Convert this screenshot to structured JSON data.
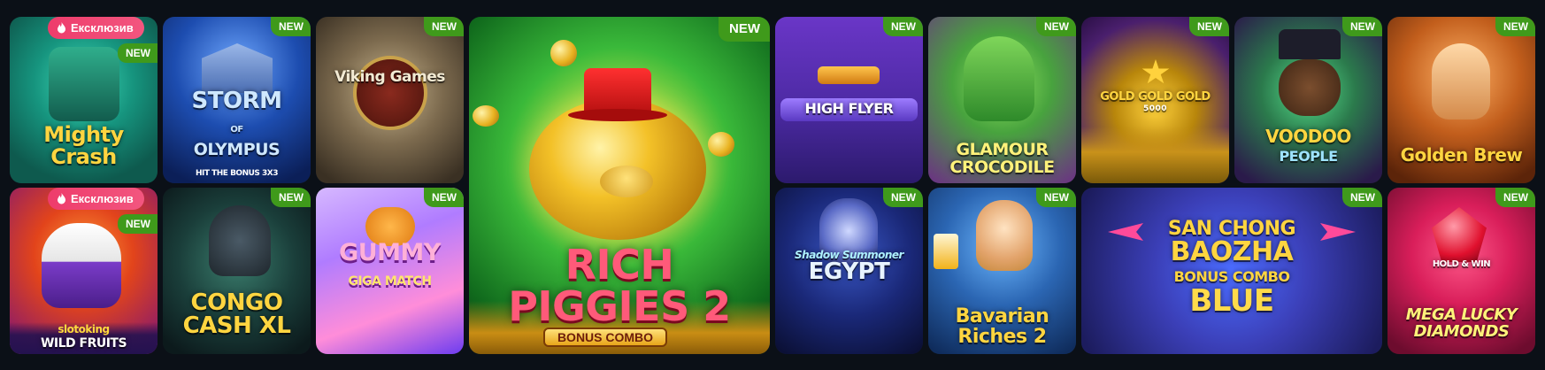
{
  "colors": {
    "background": "#0b1017",
    "new_badge": "#3f9a1b",
    "exclusive_badge": "#ee3c6b"
  },
  "badges": {
    "new": "NEW",
    "exclusive": "Ексклюзив"
  },
  "games": [
    {
      "id": "mighty-crash",
      "title": "Mighty Crash",
      "exclusive": true,
      "new": true
    },
    {
      "id": "storm-of-olympus",
      "title_line1": "STORM",
      "title_line2": "OLYMPUS",
      "title_of": "OF",
      "subtitle": "HIT THE BONUS 3X3",
      "new": true
    },
    {
      "id": "viking-games",
      "title": "Viking Games",
      "new": true
    },
    {
      "id": "rich-piggies-2",
      "title_line1": "RICH",
      "title_line2": "PIGGIES 2",
      "subtitle": "BONUS COMBO",
      "new": true
    },
    {
      "id": "high-flyer",
      "title": "HIGH FLYER",
      "new": true
    },
    {
      "id": "glamour-crocodile",
      "title_line1": "GLAMOUR",
      "title_line2": "CROCODILE",
      "new": true
    },
    {
      "id": "gold-gold-gold",
      "title": "GOLD GOLD GOLD",
      "subtitle": "5000",
      "new": true
    },
    {
      "id": "voodoo-people",
      "title_line1": "VOODOO",
      "title_line2": "PEOPLE",
      "new": true
    },
    {
      "id": "golden-brew",
      "title": "Golden Brew",
      "new": true
    },
    {
      "id": "wild-fruits",
      "brand": "slotoking",
      "title": "WILD FRUITS",
      "exclusive": true,
      "new": true
    },
    {
      "id": "congo-cash-xl",
      "title_line1": "CONGO",
      "title_line2": "CASH XL",
      "new": true
    },
    {
      "id": "gummy-giga-match",
      "title_line1": "GUMMY",
      "title_line2": "GIGA MATCH",
      "new": true
    },
    {
      "id": "shadow-summoner-egypt",
      "title_line1": "Shadow Summoner",
      "title_line2": "EGYPT",
      "new": true
    },
    {
      "id": "bavarian-riches-2",
      "title_line1": "Bavarian",
      "title_line2": "Riches 2",
      "new": true
    },
    {
      "id": "san-chong-baozha",
      "title_line1": "SAN CHONG",
      "title_line2": "BAOZHA",
      "title_line3": "BONUS COMBO",
      "title_line4": "BLUE",
      "new": true
    },
    {
      "id": "mega-lucky-diamonds",
      "badge_hold": "HOLD & WIN",
      "title_line1": "MEGA LUCKY",
      "title_line2": "DIAMONDS",
      "new": true
    }
  ]
}
